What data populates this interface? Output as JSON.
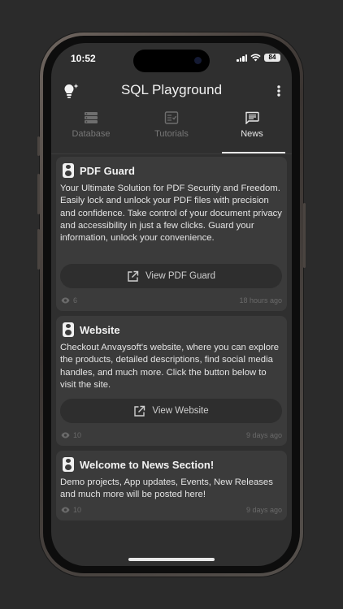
{
  "status_bar": {
    "time": "10:52",
    "battery": "84"
  },
  "app": {
    "title": "SQL Playground"
  },
  "tabs": [
    {
      "label": "Database",
      "icon": "database-icon",
      "active": false
    },
    {
      "label": "Tutorials",
      "icon": "tutorials-icon",
      "active": false
    },
    {
      "label": "News",
      "icon": "news-icon",
      "active": true
    }
  ],
  "news": [
    {
      "title": "PDF Guard",
      "body": "Your Ultimate Solution for PDF Security and Freedom. Easily lock and unlock your PDF files with precision and confidence. Take control of your document privacy and accessibility in just a few clicks. Guard your information, unlock your convenience.",
      "button": "View PDF Guard",
      "views": "6",
      "ago": "18 hours ago"
    },
    {
      "title": "Website",
      "body": "Checkout Anvaysoft's website, where you can explore the products, detailed descriptions, find social media handles, and much more. Click the button below to visit the site.",
      "button": "View Website",
      "views": "10",
      "ago": "9 days ago"
    },
    {
      "title": "Welcome to News Section!",
      "body": "Demo projects, App updates, Events, New Releases and much more will be posted here!",
      "views": "10",
      "ago": "9 days ago"
    }
  ],
  "colors": {
    "background": "#2f2f2f",
    "card": "#3b3b3b",
    "button": "#2e2e2e",
    "text": "#e4e4e4"
  }
}
